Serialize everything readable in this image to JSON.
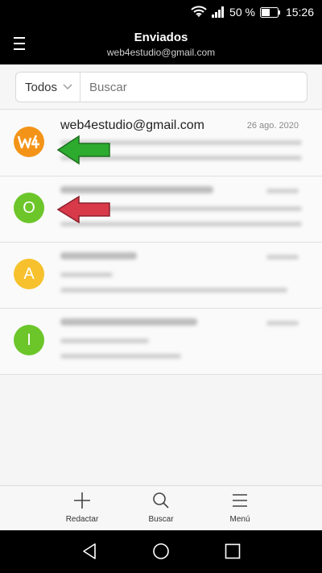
{
  "status": {
    "battery_percent": "50 %",
    "time": "15:26"
  },
  "header": {
    "title": "Enviados",
    "account": "web4estudio@gmail.com"
  },
  "search": {
    "filter_label": "Todos",
    "placeholder": "Buscar"
  },
  "messages": [
    {
      "avatar_letter": "W4",
      "avatar_color": "#f39418",
      "sender": "web4estudio@gmail.com",
      "date": "26 ago. 2020"
    },
    {
      "avatar_letter": "O",
      "avatar_color": "#6cc62a"
    },
    {
      "avatar_letter": "A",
      "avatar_color": "#f7c12e"
    },
    {
      "avatar_letter": "I",
      "avatar_color": "#6cc62a"
    }
  ],
  "annotations": {
    "arrow_1_color": "#2dab2f",
    "arrow_2_color": "#d83a4a"
  },
  "bottom_nav": [
    {
      "label": "Redactar",
      "icon": "plus-icon"
    },
    {
      "label": "Buscar",
      "icon": "search-icon"
    },
    {
      "label": "Menú",
      "icon": "hamburger-icon"
    }
  ],
  "colors": {
    "bar_bg": "#000000",
    "list_bg": "#fafafa"
  }
}
